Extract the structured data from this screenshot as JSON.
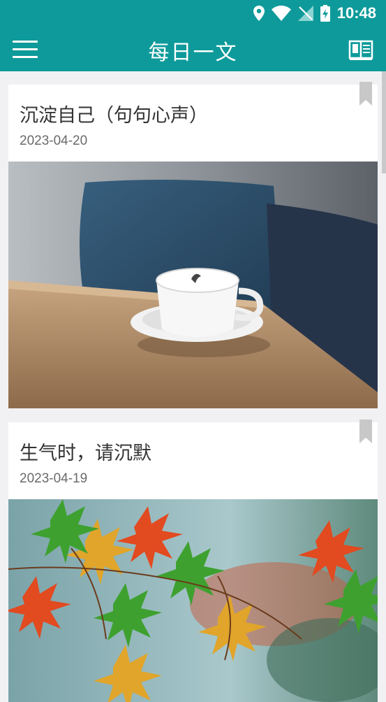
{
  "status_bar": {
    "time": "10:48",
    "icons": [
      "location-icon",
      "wifi-icon",
      "no-sim-icon",
      "battery-charging-icon"
    ]
  },
  "app_bar": {
    "title": "每日一文",
    "menu_icon": "hamburger-menu-icon",
    "book_icon": "book-icon"
  },
  "articles": [
    {
      "title": "沉淀自己（句句心声）",
      "date": "2023-04-20",
      "image": "coffee-cup-on-table-photo",
      "bookmark_icon": "bookmark-icon"
    },
    {
      "title": "生气时，请沉默",
      "date": "2023-04-19",
      "image": "autumn-maple-leaves-photo",
      "bookmark_icon": "bookmark-icon"
    }
  ],
  "colors": {
    "primary": "#0e9a9a",
    "background": "#f1f1f3",
    "bookmark": "#c8c8c8"
  }
}
